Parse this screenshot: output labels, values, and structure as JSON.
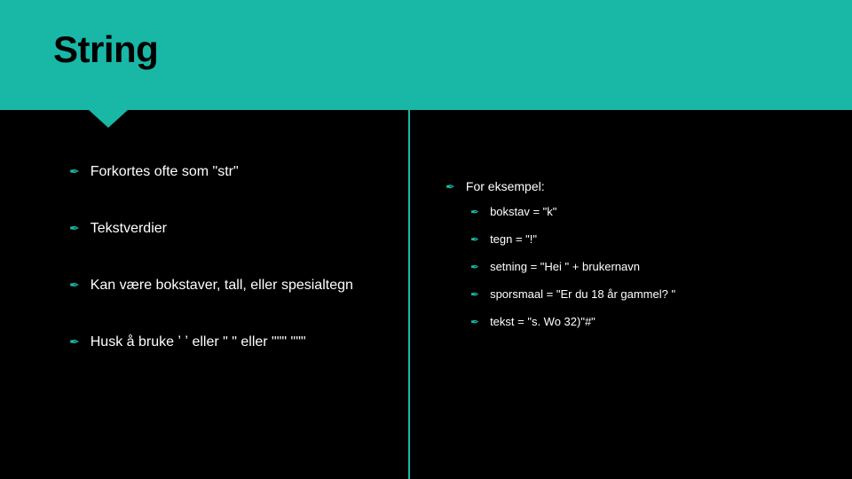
{
  "header": {
    "title": "String"
  },
  "left": {
    "items": [
      "Forkortes ofte som \"str\"",
      "Tekstverdier",
      "Kan være bokstaver, tall, eller spesialtegn",
      "Husk å bruke ʼ   ʼ eller ʺ   ʺ eller ʺʺʺ   ʺʺʺ"
    ]
  },
  "right": {
    "heading": "For eksempel:",
    "examples": [
      "bokstav = \"k\"",
      "tegn = \"!\"",
      "setning = \"Hei \" + brukernavn",
      "sporsmaal = \"Er du 18 år gammel? \"",
      "tekst = \"s. Wo 32)\"#\""
    ]
  }
}
